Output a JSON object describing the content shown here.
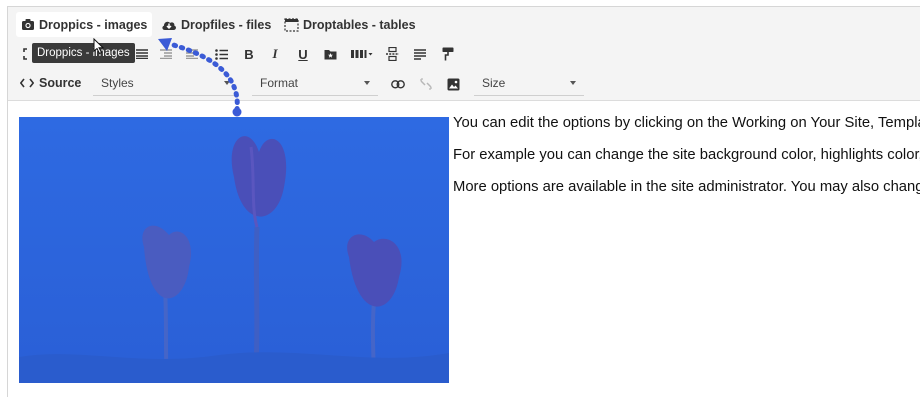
{
  "tabs": [
    {
      "label": "Droppics - images",
      "icon": "camera-icon"
    },
    {
      "label": "Dropfiles - files",
      "icon": "cloud-download-icon"
    },
    {
      "label": "Droptables - tables",
      "icon": "table-icon"
    }
  ],
  "tooltip": "Droppics - images",
  "toolbar": {
    "bold_label": "B",
    "italic_label": "I",
    "underline_label": "U",
    "source_label": "Source",
    "styles_placeholder": "Styles",
    "format_placeholder": "Format",
    "size_placeholder": "Size"
  },
  "content": {
    "paragraphs": [
      "You can edit the options by clicking on the Working on Your Site, Template Settings menu link in the top position on this page.",
      "For example you can change the site background color, highlights color, site title, site description and more.",
      "More options are available in the site administrator. You may also change the template style."
    ]
  },
  "colors": {
    "accent_blue": "#3b5bd6",
    "image_blue": "#2f67e0",
    "toolbar_bg": "#f4f4f4"
  }
}
